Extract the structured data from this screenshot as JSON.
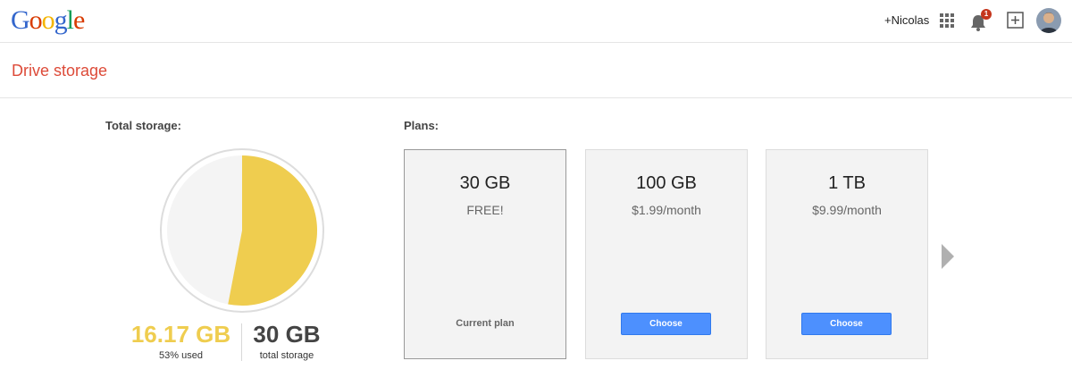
{
  "topbar": {
    "logo_letters": [
      {
        "ch": "G",
        "color": "#3366cc"
      },
      {
        "ch": "o",
        "color": "#d83b01"
      },
      {
        "ch": "o",
        "color": "#f4b400"
      },
      {
        "ch": "g",
        "color": "#3366cc"
      },
      {
        "ch": "l",
        "color": "#0f9d58"
      },
      {
        "ch": "e",
        "color": "#d83b01"
      }
    ],
    "user_link": "+Nicolas",
    "notification_count": "1",
    "apps_icon": "apps-grid-icon",
    "bell_icon": "bell-icon",
    "share_icon": "add-box-icon",
    "avatar_icon": "avatar-icon"
  },
  "header": {
    "title": "Drive storage"
  },
  "storage": {
    "label": "Total storage:",
    "used_value": "16.17 GB",
    "used_caption": "53% used",
    "used_fraction": 0.53,
    "used_color": "#efcd4f",
    "total_value": "30 GB",
    "total_caption": "total storage"
  },
  "plans": {
    "label": "Plans:",
    "items": [
      {
        "size": "30 GB",
        "price": "FREE!",
        "status": "Current plan",
        "button": ""
      },
      {
        "size": "100 GB",
        "price": "$1.99/month",
        "status": "",
        "button": "Choose"
      },
      {
        "size": "1 TB",
        "price": "$9.99/month",
        "status": "",
        "button": "Choose"
      }
    ],
    "next_icon": "chevron-right-icon"
  }
}
